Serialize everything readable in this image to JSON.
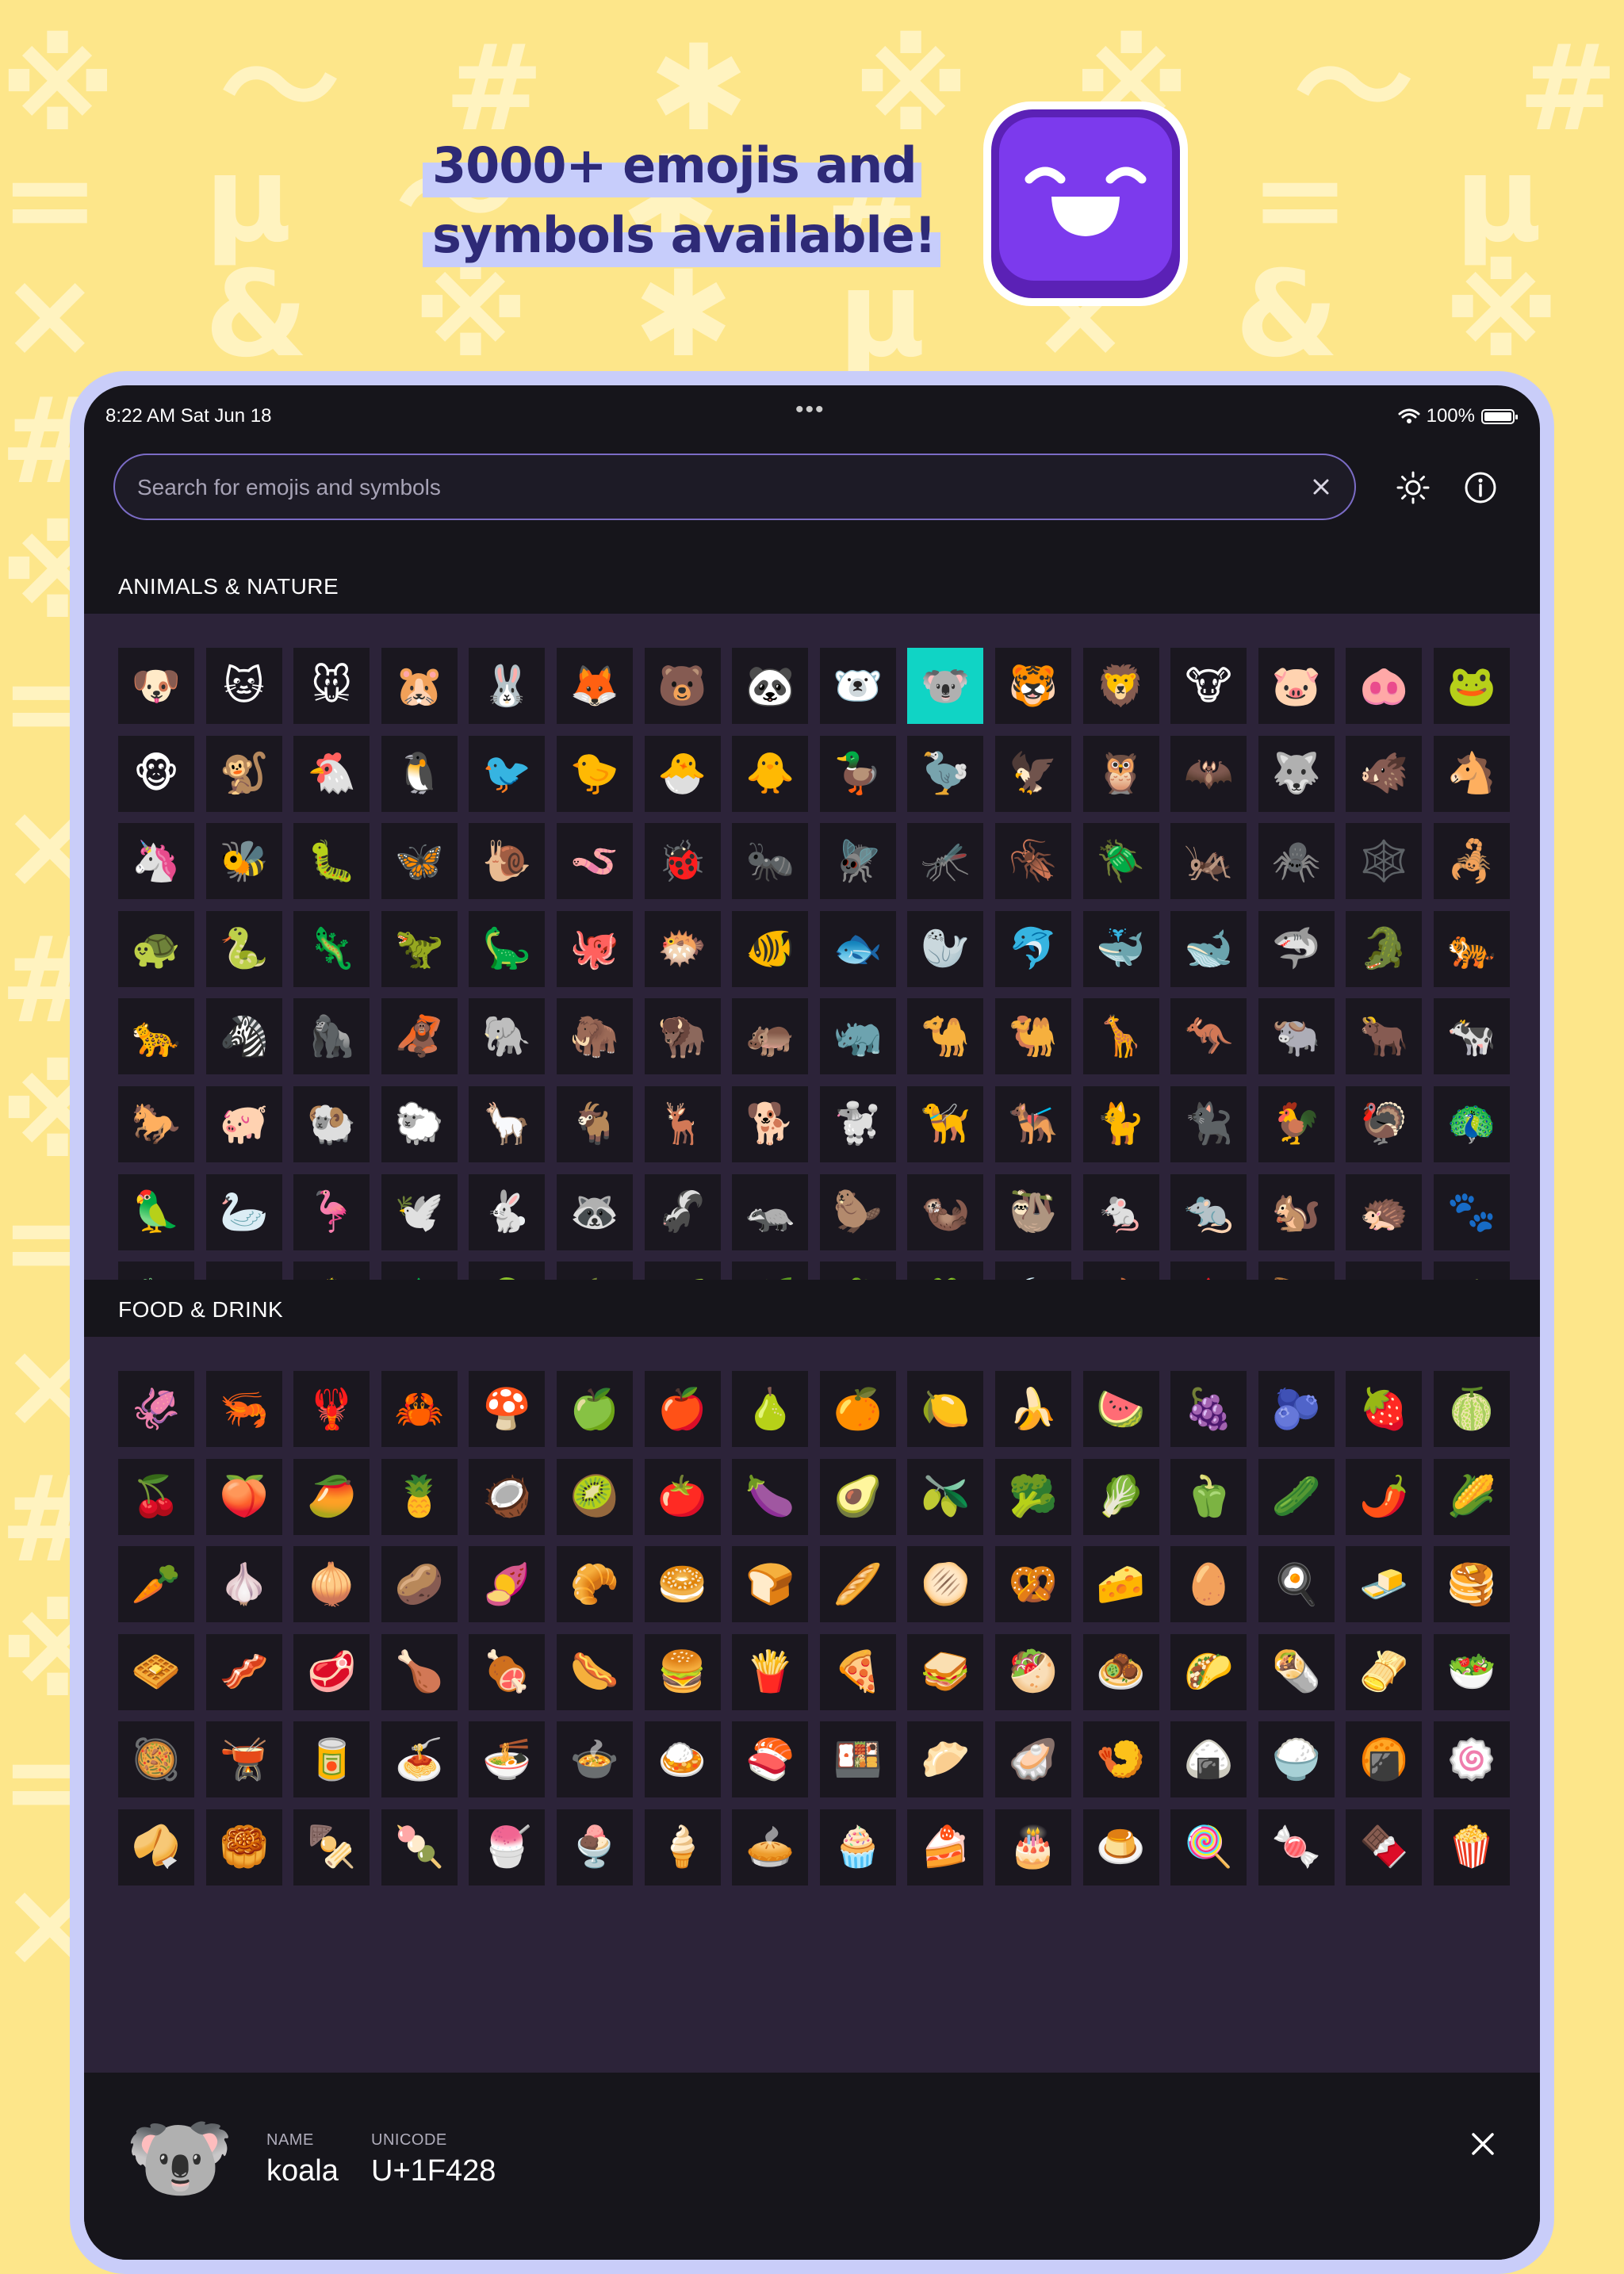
{
  "background": {
    "color": "#fde68a",
    "rows": [
      "※ 〜 # ✱ ※ ※ 〜 # ✱ ※ ※ 〜 #",
      "= μ 〜 ✱ # ※ = μ 〜 = μ 〜 ✱ #",
      "× & ※ ✱ μ × & ※ ✱ μ × & ※ ✱",
      "#                            #",
      "※                            ※",
      "=                            =",
      "×                            ×",
      "#                            #",
      "※                            ※",
      "=                            =",
      "×                            ×",
      "#                            #",
      "※                            ※",
      "=                            =",
      "×                            ×"
    ]
  },
  "headline": {
    "line1": "3000+ emojis and",
    "line2": "symbols available!"
  },
  "app_icon": {
    "name": "smiling-face-app-icon",
    "color": "#7c3aed"
  },
  "status_bar": {
    "time": "8:22 AM   Sat Jun 18",
    "dots": "•••",
    "battery": "100%"
  },
  "search": {
    "placeholder": "Search for emojis and symbols",
    "value": ""
  },
  "toolbar": {
    "theme_icon": "sun-icon",
    "info_icon": "info-icon",
    "clear_icon": "close-icon"
  },
  "sections": [
    {
      "title": "ANIMALS & NATURE",
      "selected_index": 9,
      "emojis": [
        "🐶",
        "🐱",
        "🐭",
        "🐹",
        "🐰",
        "🦊",
        "🐻",
        "🐼",
        "🐻‍❄️",
        "🐨",
        "🐯",
        "🦁",
        "🐮",
        "🐷",
        "🐽",
        "🐸",
        "🐵",
        "🐒",
        "🐔",
        "🐧",
        "🐦",
        "🐤",
        "🐣",
        "🐥",
        "🦆",
        "🦤",
        "🦅",
        "🦉",
        "🦇",
        "🐺",
        "🐗",
        "🐴",
        "🦄",
        "🐝",
        "🐛",
        "🦋",
        "🐌",
        "🪱",
        "🐞",
        "🐜",
        "🪰",
        "🦟",
        "🪳",
        "🪲",
        "🦗",
        "🕷️",
        "🕸️",
        "🦂",
        "🐢",
        "🐍",
        "🦎",
        "🦖",
        "🦕",
        "🐙",
        "🐡",
        "🐠",
        "🐟",
        "🦭",
        "🐬",
        "🐳",
        "🐋",
        "🦈",
        "🐊",
        "🐅",
        "🐆",
        "🦓",
        "🦍",
        "🦧",
        "🐘",
        "🦣",
        "🦬",
        "🦛",
        "🦏",
        "🐪",
        "🐫",
        "🦒",
        "🦘",
        "🐃",
        "🐂",
        "🐄",
        "🐎",
        "🐖",
        "🐏",
        "🐑",
        "🦙",
        "🐐",
        "🦌",
        "🐕",
        "🐩",
        "🦮",
        "🐕‍🦺",
        "🐈",
        "🐈‍⬛",
        "🐓",
        "🦃",
        "🦚",
        "🦜",
        "🦢",
        "🦩",
        "🕊️",
        "🐇",
        "🦝",
        "🦨",
        "🦡",
        "🦫",
        "🦦",
        "🦥",
        "🐁",
        "🐀",
        "🐿️",
        "🦔",
        "🐾",
        "🐉",
        "🐲",
        "🌵",
        "🌲",
        "🌳",
        "🌴",
        "🌱",
        "🌿",
        "☘️",
        "🍀",
        "🍃",
        "🍂",
        "🍁",
        "🪶",
        "🐚",
        "🌾",
        "🪴",
        "💐",
        "🌷",
        "🌹",
        "🥀",
        "🌺",
        "🌸",
        "🌼",
        "🌻",
        "🏵️",
        "🦠",
        "💮"
      ]
    },
    {
      "title": "FOOD & DRINK",
      "emojis": [
        "🦑",
        "🦐",
        "🦞",
        "🦀",
        "🍄",
        "🍏",
        "🍎",
        "🍐",
        "🍊",
        "🍋",
        "🍌",
        "🍉",
        "🍇",
        "🫐",
        "🍓",
        "🍈",
        "🍒",
        "🍑",
        "🥭",
        "🍍",
        "🥥",
        "🥝",
        "🍅",
        "🍆",
        "🥑",
        "🫒",
        "🥦",
        "🥬",
        "🫑",
        "🥒",
        "🌶️",
        "🌽",
        "🥕",
        "🧄",
        "🧅",
        "🥔",
        "🍠",
        "🥐",
        "🥯",
        "🍞",
        "🥖",
        "🫓",
        "🥨",
        "🧀",
        "🥚",
        "🍳",
        "🧈",
        "🥞",
        "🧇",
        "🥓",
        "🥩",
        "🍗",
        "🍖",
        "🌭",
        "🍔",
        "🍟",
        "🍕",
        "🥪",
        "🥙",
        "🧆",
        "🌮",
        "🌯",
        "🫔",
        "🥗",
        "🥘",
        "🫕",
        "🥫",
        "🍝",
        "🍜",
        "🍲",
        "🍛",
        "🍣",
        "🍱",
        "🥟",
        "🦪",
        "🍤",
        "🍙",
        "🍚",
        "🍘",
        "🍥",
        "🥠",
        "🥮",
        "🍢",
        "🍡",
        "🍧",
        "🍨",
        "🍦",
        "🥧",
        "🧁",
        "🍰",
        "🎂",
        "🍮",
        "🍭",
        "🍬",
        "🍫",
        "🍿"
      ]
    }
  ],
  "detail_panel": {
    "emoji": "🐨",
    "name_label": "NAME",
    "name_value": "koala",
    "unicode_label": "UNICODE",
    "unicode_value": "U+1F428",
    "close_icon": "close-icon"
  }
}
